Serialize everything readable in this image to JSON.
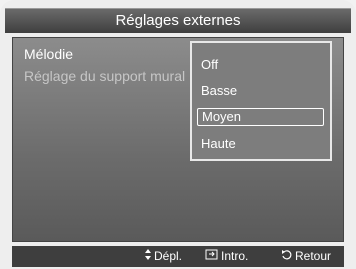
{
  "header": {
    "title": "Réglages externes"
  },
  "menu": {
    "items": [
      {
        "label": "Mélodie"
      },
      {
        "label": "Réglage du support mural"
      }
    ]
  },
  "dropdown": {
    "options": [
      "Off",
      "Basse",
      "Moyen",
      "Haute"
    ],
    "selected": "Moyen"
  },
  "footer": {
    "move": {
      "icon": "up-down-arrow-icon",
      "label": "Dépl."
    },
    "enter": {
      "icon": "enter-icon",
      "label": "Intro."
    },
    "back": {
      "icon": "return-icon",
      "label": "Retour"
    }
  }
}
